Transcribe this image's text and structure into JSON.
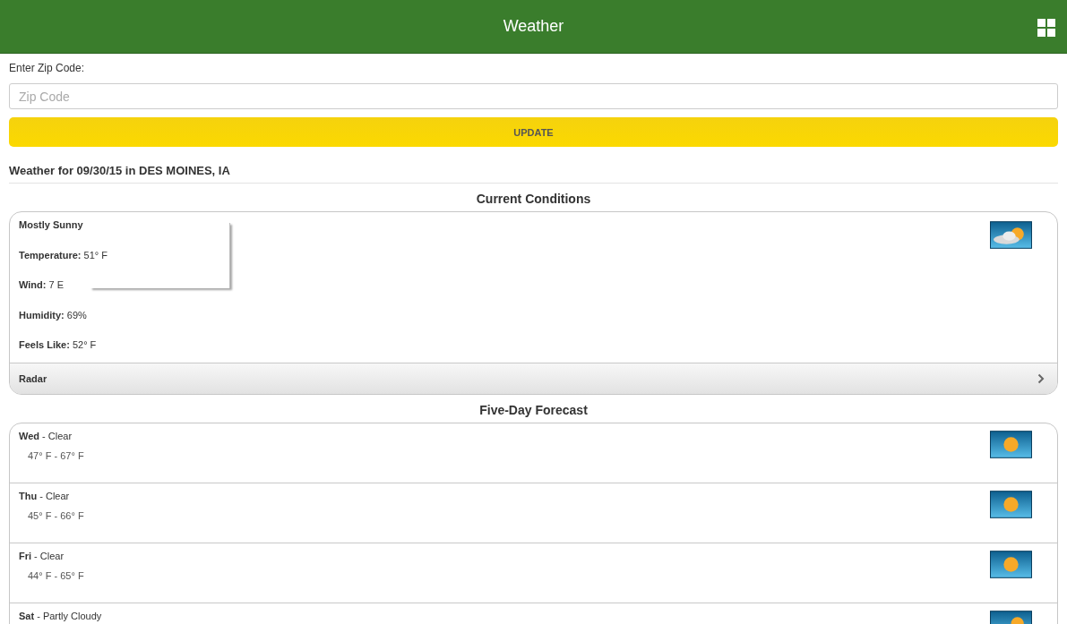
{
  "header": {
    "title": "Weather"
  },
  "zip": {
    "label": "Enter Zip Code:",
    "placeholder": "Zip Code"
  },
  "update_button": "UPDATE",
  "location_heading": "Weather for 09/30/15 in DES MOINES, IA",
  "current": {
    "title": "Current Conditions",
    "summary": "Mostly Sunny",
    "kind": "partly-cloudy",
    "details": [
      {
        "label": "Temperature:",
        "value": "51° F"
      },
      {
        "label": "Wind:",
        "value": "7 E"
      },
      {
        "label": "Humidity:",
        "value": "69%"
      },
      {
        "label": "Feels Like:",
        "value": "52° F"
      }
    ],
    "radar": "Radar"
  },
  "forecast": {
    "title": "Five-Day Forecast",
    "days": [
      {
        "day": "Wed",
        "condition": "- Clear",
        "range": "47° F - 67° F",
        "kind": "clear"
      },
      {
        "day": "Thu",
        "condition": "- Clear",
        "range": "45° F - 66° F",
        "kind": "clear"
      },
      {
        "day": "Fri",
        "condition": "- Clear",
        "range": "44° F - 65° F",
        "kind": "clear"
      },
      {
        "day": "Sat",
        "condition": "- Partly Cloudy",
        "kind": "partly-cloudy"
      }
    ]
  }
}
